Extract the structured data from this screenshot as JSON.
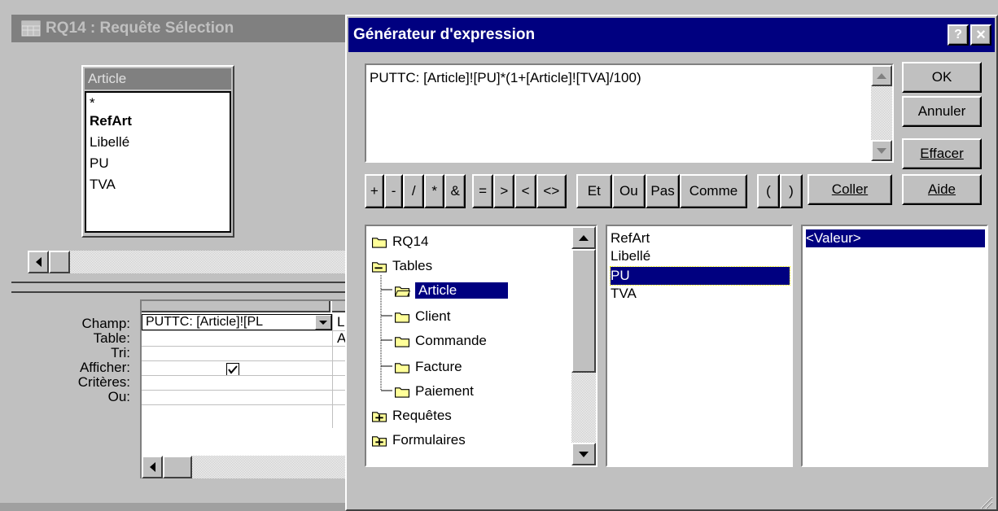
{
  "query_window": {
    "title": "RQ14 : Requête Sélection",
    "table": {
      "name": "Article",
      "fields": [
        "*",
        "RefArt",
        "Libellé",
        "PU",
        "TVA"
      ]
    },
    "grid": {
      "row_labels": [
        "Champ:",
        "Table:",
        "Tri:",
        "Afficher:",
        "Critères:",
        "Ou:"
      ],
      "col1": {
        "field": "PUTTC: [Article]![PL",
        "table": "",
        "show": true
      },
      "col2": {
        "field": "L",
        "table": "A"
      }
    }
  },
  "builder": {
    "title": "Générateur d'expression",
    "help_btn": "?",
    "close_btn": "×",
    "expression": "PUTTC: [Article]![PU]*(1+[Article]![TVA]/100)",
    "buttons": {
      "ok": "OK",
      "cancel": "Annuler",
      "clear": "Effacer",
      "help": "Aide",
      "paste": "Coller"
    },
    "operators_arith": [
      "+",
      "-",
      "/",
      "*",
      "&"
    ],
    "operators_comp": [
      "=",
      ">",
      "<",
      "<>"
    ],
    "operators_logic": [
      "Et",
      "Ou",
      "Pas",
      "Comme"
    ],
    "parens": [
      "(",
      ")"
    ],
    "tree": {
      "root": "RQ14",
      "tables_label": "Tables",
      "tables": [
        "Article",
        "Client",
        "Commande",
        "Facture",
        "Paiement"
      ],
      "selected": "Article",
      "queries_label": "Requêtes",
      "forms_label": "Formulaires"
    },
    "fields_list": [
      "RefArt",
      "Libellé",
      "PU",
      "TVA"
    ],
    "selected_field": "PU",
    "values_list": [
      "<Valeur>"
    ]
  }
}
